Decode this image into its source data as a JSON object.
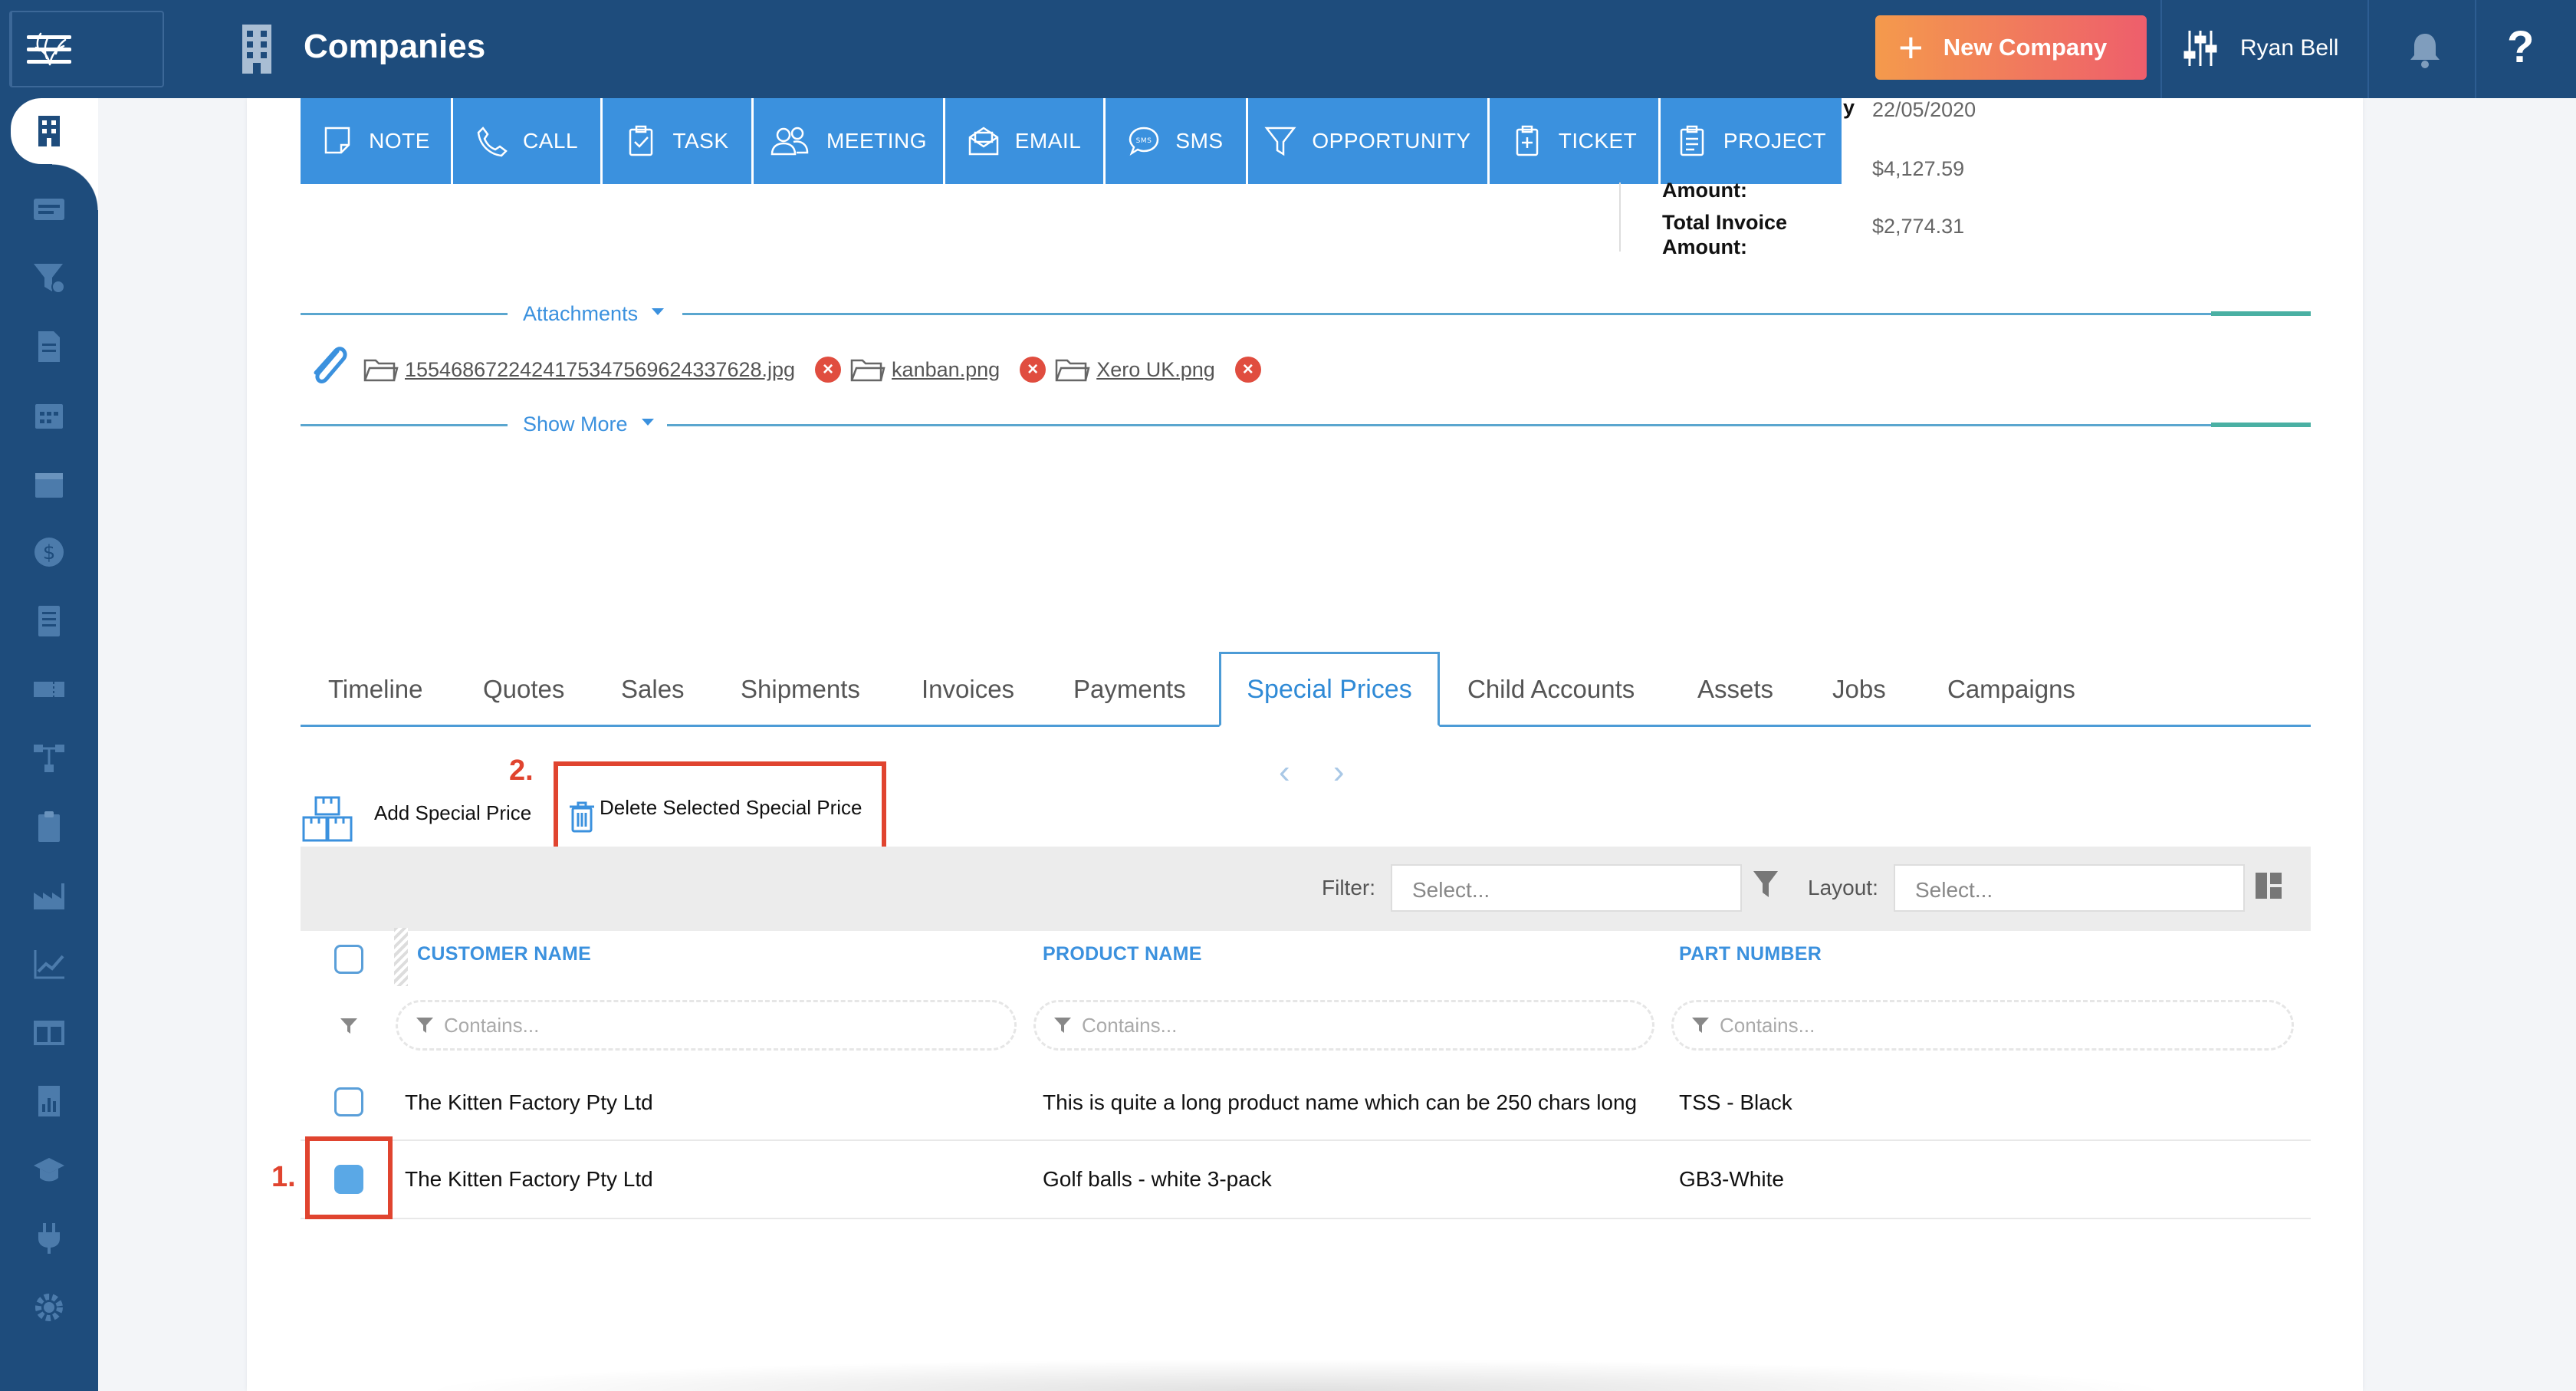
{
  "header": {
    "title": "Companies",
    "new_button": "New Company",
    "user_name": "Ryan Bell",
    "help_label": "?"
  },
  "sidebar": {
    "icons": [
      "companies-icon",
      "contacts-card-icon",
      "sales-funnel-icon",
      "document-icon",
      "calendar-icon",
      "calendar-alt-icon",
      "dollar-icon",
      "list-icon",
      "ticket-icon",
      "workflow-icon",
      "clipboard-icon",
      "factory-icon",
      "analytics-icon",
      "layout-icon",
      "reports-icon",
      "academy-icon",
      "plug-icon",
      "settings-icon"
    ]
  },
  "activity_buttons": [
    {
      "label": "NOTE",
      "icon": "note-icon"
    },
    {
      "label": "CALL",
      "icon": "phone-icon"
    },
    {
      "label": "TASK",
      "icon": "task-icon"
    },
    {
      "label": "MEETING",
      "icon": "meeting-icon"
    },
    {
      "label": "EMAIL",
      "icon": "email-icon"
    },
    {
      "label": "SMS",
      "icon": "sms-icon"
    },
    {
      "label": "OPPORTUNITY",
      "icon": "funnel-icon"
    },
    {
      "label": "TICKET",
      "icon": "ticket-icon"
    },
    {
      "label": "PROJECT",
      "icon": "project-icon"
    }
  ],
  "summary": {
    "partial_label": "y",
    "date_value": "22/05/2020",
    "amount_label": "Amount:",
    "amount_value": "$4,127.59",
    "total_invoice_label": "Total Invoice Amount:",
    "total_invoice_label_line1": "Total Invoice",
    "total_invoice_label_line2": "Amount:",
    "total_invoice_value": "$2,774.31"
  },
  "attachments": {
    "section_label": "Attachments",
    "files": [
      "15546867224241753475696243376 28.jpg",
      "kanban.png",
      "Xero UK.png"
    ],
    "file1": "15546867224241753475696243376​28.jpg",
    "file2": "kanban.png",
    "file3": "Xero UK.png",
    "remove_symbol": "×",
    "show_more": "Show More"
  },
  "tabs": {
    "items": [
      "Timeline",
      "Quotes",
      "Sales",
      "Shipments",
      "Invoices",
      "Payments",
      "Special Prices",
      "Child Accounts",
      "Assets",
      "Jobs",
      "Campaigns"
    ],
    "active": "Special Prices"
  },
  "pager": "‹ ›",
  "grid_toolbar": {
    "add_label": "Add Special Price",
    "delete_label": "Delete Selected Special Price",
    "step1": "1.",
    "step2": "2."
  },
  "filter_bar": {
    "filter_label": "Filter:",
    "filter_placeholder": "Select...",
    "layout_label": "Layout:",
    "layout_placeholder": "Select..."
  },
  "table": {
    "columns": [
      "CUSTOMER NAME",
      "PRODUCT NAME",
      "PART NUMBER"
    ],
    "filter_placeholder": "Contains...",
    "rows": [
      {
        "customer": "The Kitten Factory Pty Ltd",
        "product": "This is quite a long product name which can be 250 chars long",
        "part": "TSS - Black",
        "selected": false
      },
      {
        "customer": "The Kitten Factory Pty Ltd",
        "product": "Golf balls - white 3-pack",
        "part": "GB3-White",
        "selected": true
      }
    ]
  },
  "colors": {
    "topbar": "#1e4c7c",
    "activity_button": "#3b91de",
    "accent": "#3b91de",
    "annotation_red": "#e0442f",
    "new_button_gradient_start": "#f49a4c",
    "new_button_gradient_end": "#ee5e6c"
  }
}
